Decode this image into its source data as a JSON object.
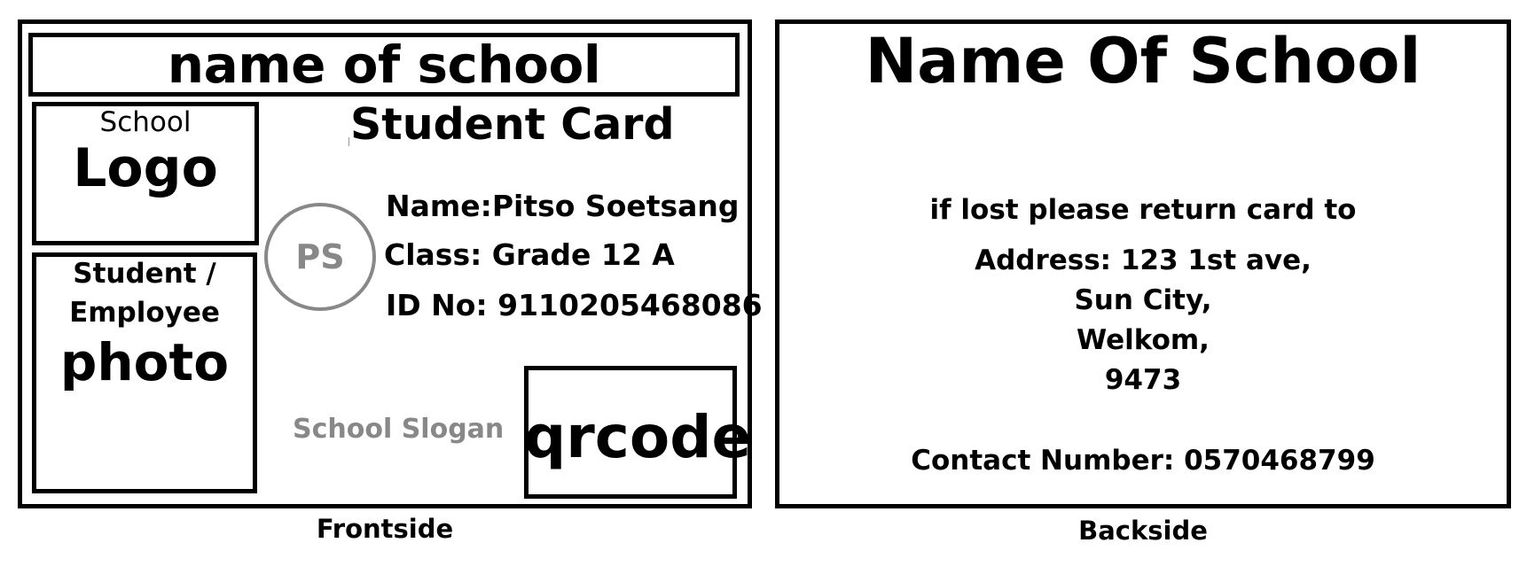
{
  "front": {
    "school_name": "name of school",
    "logo_small": "School",
    "logo_big": "Logo",
    "photo_line1": "Student /",
    "photo_line2": "Employee",
    "photo_line3": "photo",
    "card_title": "Student Card",
    "initials": "PS",
    "name_field": "Name:Pitso Soetsang",
    "class_field": "Class: Grade 12 A",
    "id_field": "ID No: 9110205468086",
    "slogan": "School Slogan",
    "qrcode": "qrcode",
    "caption": "Frontside"
  },
  "back": {
    "school_name": "Name Of School",
    "lost_line": "if lost please return card to",
    "address_line1": "Address: 123 1st ave,",
    "address_line2": "Sun City,",
    "address_line3": "Welkom,",
    "address_line4": "9473",
    "contact": "Contact Number: 0570468799",
    "caption": "Backside"
  },
  "colors": {
    "border": "#000000",
    "muted_gray": "#888888",
    "background": "#ffffff"
  }
}
